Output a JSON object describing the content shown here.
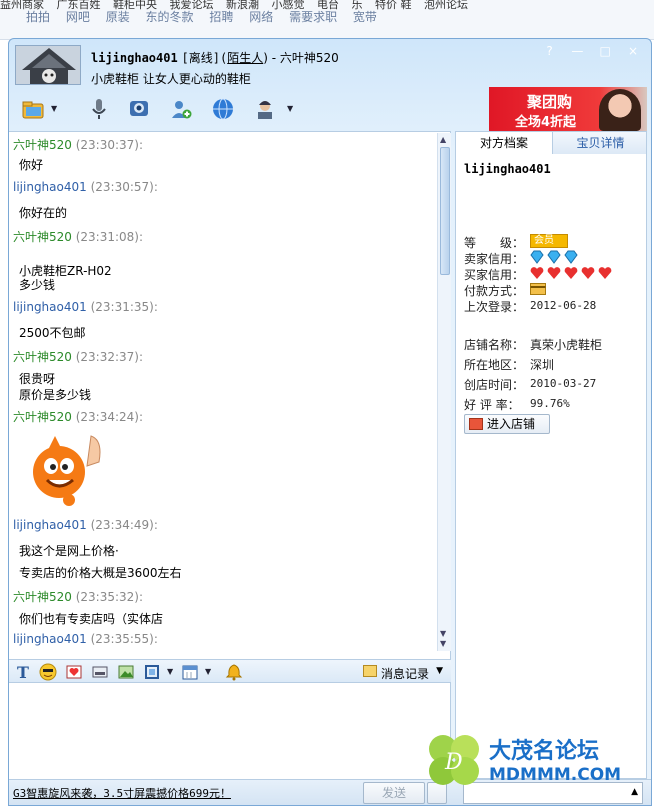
{
  "browser": {
    "row1": [
      "益州商家",
      "广东百姓",
      "鞋柜中央",
      "我爱论坛",
      "新浪潮",
      "小感觉",
      "电台",
      "乐",
      "特价 鞋",
      "泡州论坛"
    ],
    "row2": [
      "拍拍",
      "网吧",
      "原装",
      "东的冬款",
      "招聘",
      "网络",
      "需要求职",
      "宽带"
    ]
  },
  "window": {
    "title_name": "lijinghao401",
    "title_status": "[离线](",
    "title_stranger": "陌生人",
    "title_suffix": ") - 六叶神520",
    "subtitle": "小虎鞋柜 让女人更心动的鞋柜",
    "controls": [
      "?",
      "—",
      "□",
      "×"
    ]
  },
  "ad": {
    "line1": "聚团购",
    "line2": "全场4折起"
  },
  "messages": [
    {
      "sender": "六叶神520",
      "time": "(23:30:37):",
      "lines": [
        "你好"
      ]
    },
    {
      "sender": "lijinghao401",
      "time": "(23:30:57):",
      "lines": [
        "你好在的"
      ]
    },
    {
      "sender": "六叶神520",
      "time": "(23:31:08):",
      "lines": [
        "小虎鞋柜ZR-H02",
        "多少钱"
      ]
    },
    {
      "sender": "lijinghao401",
      "time": "(23:31:35):",
      "lines": [
        "2500不包邮"
      ]
    },
    {
      "sender": "六叶神520",
      "time": "(23:32:37):",
      "lines": [
        "很贵呀",
        "原价是多少钱"
      ]
    },
    {
      "sender": "六叶神520",
      "time": "(23:34:24):",
      "lines": []
    },
    {
      "sender": "lijinghao401",
      "time": "(23:34:49):",
      "lines": [
        "我这个是网上价格·",
        "专卖店的价格大概是3600左右"
      ]
    },
    {
      "sender": "六叶神520",
      "time": "(23:35:32):",
      "lines": [
        "你们也有专卖店吗（实体店"
      ]
    },
    {
      "sender": "lijinghao401",
      "time": "(23:35:55):",
      "lines": []
    }
  ],
  "format_bar": {
    "history_label": "消息记录"
  },
  "bottom": {
    "promo": "G3智惠旋风来袭，3.5寸屏震撼价格699元！",
    "send_label": "发送"
  },
  "profile": {
    "tab1": "对方档案",
    "tab2": "宝贝详情",
    "name": "lijinghao401",
    "level_label": "等　　级：",
    "level_badge": "会员",
    "seller_credit_label": "卖家信用：",
    "buyer_credit_label": "买家信用：",
    "payment_label": "付款方式：",
    "last_login_label": "上次登录：",
    "last_login": "2012-06-28",
    "shop_name_label": "店铺名称：",
    "shop_name": "真荣小虎鞋柜",
    "region_label": "所在地区：",
    "region": "深圳",
    "founded_label": "创店时间：",
    "founded": "2010-03-27",
    "rating_label": "好 评 率：",
    "rating": "99.76%",
    "enter_shop": "进入店铺"
  },
  "watermark": {
    "title": "大茂名论坛",
    "url": "MDMMM.COM"
  },
  "colors": {
    "sender_a": "#2c8a2a",
    "sender_b": "#3060a8",
    "accent": "#1a6fc8"
  }
}
